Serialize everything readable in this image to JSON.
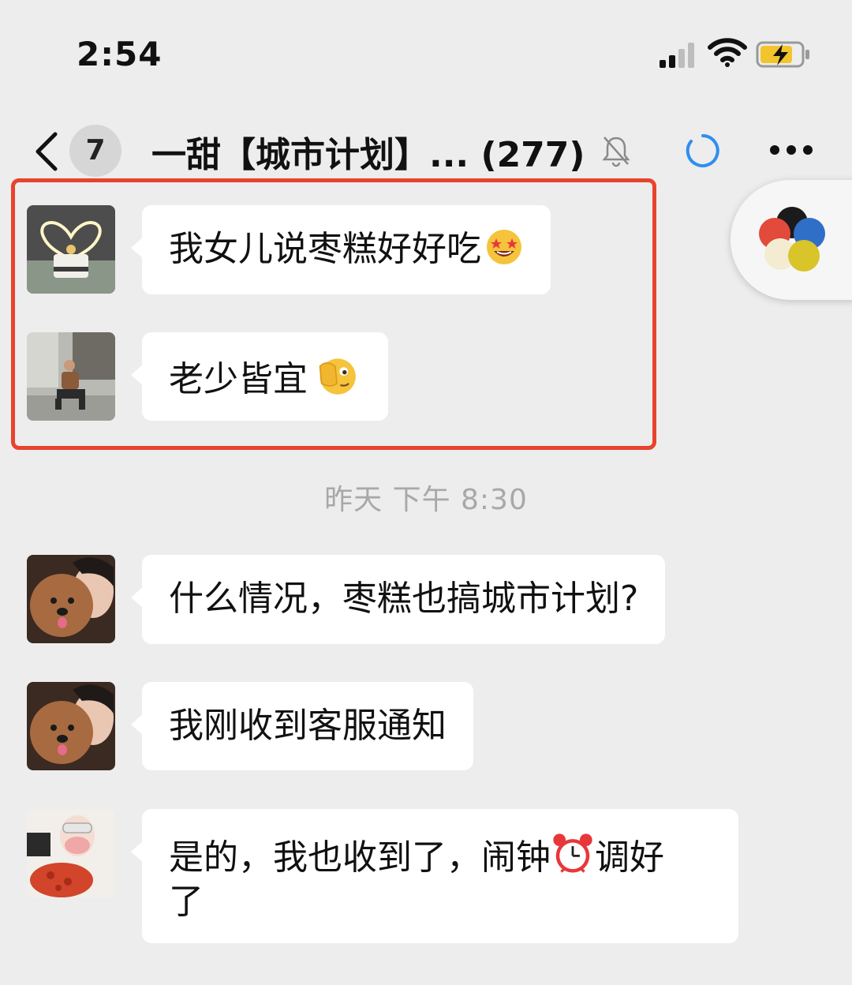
{
  "status_bar": {
    "time": "2:54"
  },
  "nav": {
    "unread_count": "7",
    "title": "一甜【城市计划】... (277)"
  },
  "time_divider": "昨天 下午 8:30",
  "messages": [
    {
      "text": "我女儿说枣糕好好吃",
      "emoji": "star-struck-emoji"
    },
    {
      "text": "老少皆宜",
      "emoji": "face-peeking-emoji"
    },
    {
      "text": "什么情况，枣糕也搞城市计划?"
    },
    {
      "text": "我刚收到客服通知"
    },
    {
      "text_line1": "是的，我也收到了，闹钟",
      "text_line1_after": "调好",
      "text_line2": "了",
      "emoji": "alarm-clock-emoji"
    }
  ],
  "colors": {
    "background": "#ededed",
    "bubble": "#ffffff",
    "highlight_border": "#e8432d",
    "loading_ring": "#2f8ef0"
  }
}
